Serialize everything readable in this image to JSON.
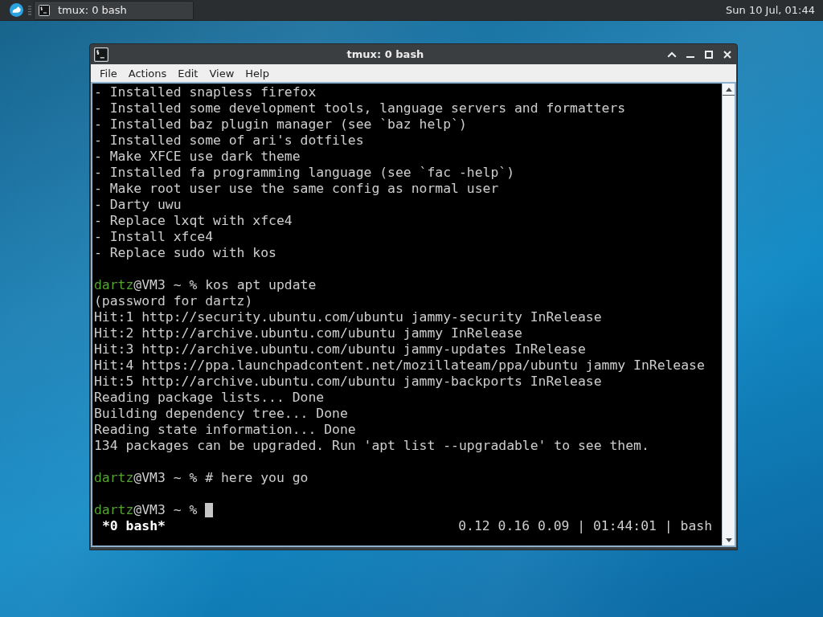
{
  "panel": {
    "taskbar_button": {
      "title": "tmux: 0 bash",
      "selected": true
    },
    "clock": "Sun 10 Jul, 01:44"
  },
  "window": {
    "title": "tmux: 0 bash",
    "menu": [
      "File",
      "Actions",
      "Edit",
      "View",
      "Help"
    ]
  },
  "terminal": {
    "lines": [
      {
        "kind": "output",
        "text": "- Installed snapless firefox"
      },
      {
        "kind": "output",
        "text": "- Installed some development tools, language servers and formatters"
      },
      {
        "kind": "output",
        "text": "- Installed baz plugin manager (see `baz help`)"
      },
      {
        "kind": "output",
        "text": "- Installed some of ari's dotfiles"
      },
      {
        "kind": "output",
        "text": "- Make XFCE use dark theme"
      },
      {
        "kind": "output",
        "text": "- Installed fa programming language (see `fac -help`)"
      },
      {
        "kind": "output",
        "text": "- Make root user use the same config as normal user"
      },
      {
        "kind": "output",
        "text": "- Darty uwu"
      },
      {
        "kind": "output",
        "text": "- Replace lxqt with xfce4"
      },
      {
        "kind": "output",
        "text": "- Install xfce4"
      },
      {
        "kind": "output",
        "text": "- Replace sudo with kos"
      },
      {
        "kind": "blank"
      },
      {
        "kind": "prompt",
        "user": "dartz",
        "host": "@VM3 ~ %",
        "command": "kos apt update"
      },
      {
        "kind": "output",
        "text": "(password for dartz)"
      },
      {
        "kind": "output",
        "text": "Hit:1 http://security.ubuntu.com/ubuntu jammy-security InRelease"
      },
      {
        "kind": "output",
        "text": "Hit:2 http://archive.ubuntu.com/ubuntu jammy InRelease"
      },
      {
        "kind": "output",
        "text": "Hit:3 http://archive.ubuntu.com/ubuntu jammy-updates InRelease"
      },
      {
        "kind": "output",
        "text": "Hit:4 https://ppa.launchpadcontent.net/mozillateam/ppa/ubuntu jammy InRelease"
      },
      {
        "kind": "output",
        "text": "Hit:5 http://archive.ubuntu.com/ubuntu jammy-backports InRelease"
      },
      {
        "kind": "output",
        "text": "Reading package lists... Done"
      },
      {
        "kind": "output",
        "text": "Building dependency tree... Done"
      },
      {
        "kind": "output",
        "text": "Reading state information... Done"
      },
      {
        "kind": "output",
        "text": "134 packages can be upgraded. Run 'apt list --upgradable' to see them."
      },
      {
        "kind": "blank"
      },
      {
        "kind": "prompt",
        "user": "dartz",
        "host": "@VM3 ~ %",
        "command": "# here you go"
      },
      {
        "kind": "blank"
      },
      {
        "kind": "prompt",
        "user": "dartz",
        "host": "@VM3 ~ %",
        "cursor": true
      }
    ],
    "status_bar": {
      "window_tab": "*0 bash*",
      "info": "0.12 0.16 0.09 | 01:44:01 | bash"
    }
  }
}
